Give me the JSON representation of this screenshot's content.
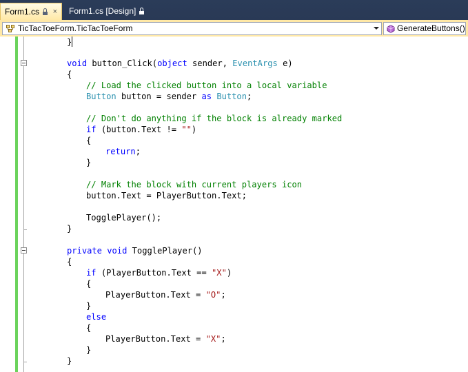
{
  "tabs": [
    {
      "label": "Form1.cs",
      "active": true
    },
    {
      "label": "Form1.cs [Design]",
      "active": false
    }
  ],
  "close_glyph": "×",
  "navbar": {
    "class_combo": "TicTacToeForm.TicTacToeForm",
    "member_combo": "GenerateButtons()"
  },
  "colors": {
    "tab_strip": "#293955",
    "active_tab": "#ffe8a6",
    "change_bar": "#6bd35c",
    "keyword": "#0000ff",
    "type": "#2b91af",
    "string": "#a31515",
    "comment": "#008000"
  },
  "code": {
    "l0": {
      "brace": "}"
    },
    "l2": {
      "kw": "void",
      "name": "button_Click(",
      "kw2": "object",
      "sender": " sender, ",
      "type": "EventArgs",
      "rest": " e)"
    },
    "l3": "{",
    "l4": "// Load the clicked button into a local variable",
    "l5": {
      "type1": "Button",
      "mid": " button = sender ",
      "kw": "as",
      "type2": "Button",
      "end": ";"
    },
    "l7": "// Don't do anything if the block is already marked",
    "l8": {
      "kw": "if",
      "mid": " (button.Text != ",
      "str": "\"\"",
      "end": ")"
    },
    "l9": "{",
    "l10": {
      "kw": "return",
      "end": ";"
    },
    "l11": "}",
    "l13": "// Mark the block with current players icon",
    "l14": "button.Text = PlayerButton.Text;",
    "l16": "TogglePlayer();",
    "l17": "}",
    "l19": {
      "kw1": "private",
      "kw2": "void",
      "name": " TogglePlayer()"
    },
    "l20": "{",
    "l21": {
      "kw": "if",
      "mid": " (PlayerButton.Text == ",
      "str": "\"X\"",
      "end": ")"
    },
    "l22": "{",
    "l23": {
      "mid": "PlayerButton.Text = ",
      "str": "\"O\"",
      "end": ";"
    },
    "l24": "}",
    "l25": {
      "kw": "else"
    },
    "l26": "{",
    "l27": {
      "mid": "PlayerButton.Text = ",
      "str": "\"X\"",
      "end": ";"
    },
    "l28": "}",
    "l29": "}"
  }
}
